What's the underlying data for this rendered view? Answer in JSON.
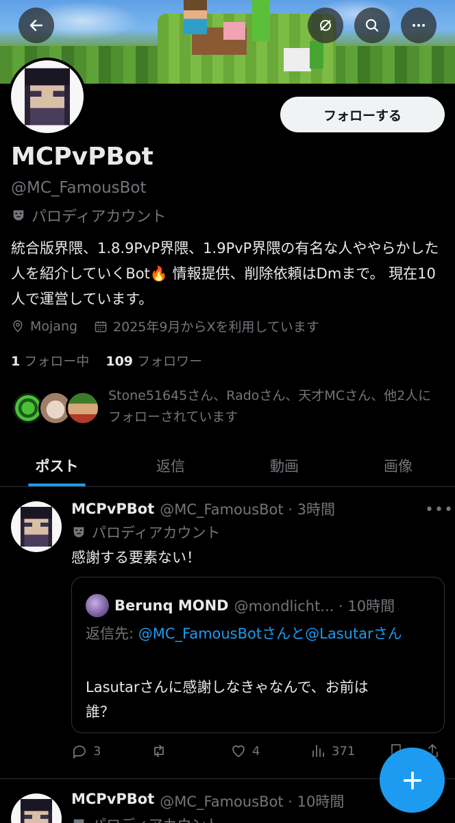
{
  "profile": {
    "name": "MCPvPBot",
    "handle": "@MC_FamousBot",
    "parody_label": "パロディアカウント",
    "bio": "統合版界隈、1.8.9PvP界隈、1.9PvP界隈の有名な人ややらかした人を紹介していくBot🔥 情報提供、削除依頼はDmまで。 現在10人で運営しています。",
    "location": "Mojang",
    "joined": "2025年9月からXを利用しています",
    "following_count": "1",
    "following_label": "フォロー中",
    "followers_count": "109",
    "followers_label": "フォロワー",
    "followed_by": "Stone51645さん、Radoさん、天才MCさん、他2人にフォローされています"
  },
  "header": {
    "follow_button": "フォローする",
    "icons": [
      "back-arrow-icon",
      "no-notifications-icon",
      "search-icon",
      "more-icon"
    ]
  },
  "tabs": [
    "ポスト",
    "返信",
    "動画",
    "画像"
  ],
  "tweet": {
    "name": "MCPvPBot",
    "handle_time": "@MC_FamousBot · 3時間",
    "parody_label": "パロディアカウント",
    "text": "感謝する要素ない！",
    "quote": {
      "name": "Berunq MOND",
      "handle_time": "@mondlicht... · 10時間",
      "reply_prefix": "返信先: ",
      "reply_user1": "@MC_FamousBot",
      "reply_mid": "さんと",
      "reply_user2": "@Lasutar",
      "reply_suffix": "さん",
      "body": "Lasutarさんに感謝しなきゃなんで、お前は誰？"
    },
    "replies": "3",
    "retweets": "",
    "likes": "4",
    "views": "371"
  },
  "tweet2": {
    "name": "MCPvPBot",
    "handle_time": "@MC_FamousBot · 10時間",
    "parody_label": "パロディアカウント"
  },
  "colors": {
    "accent": "#1d9bf0",
    "background": "#000000",
    "muted": "#71767b",
    "text": "#e7e9ea"
  }
}
